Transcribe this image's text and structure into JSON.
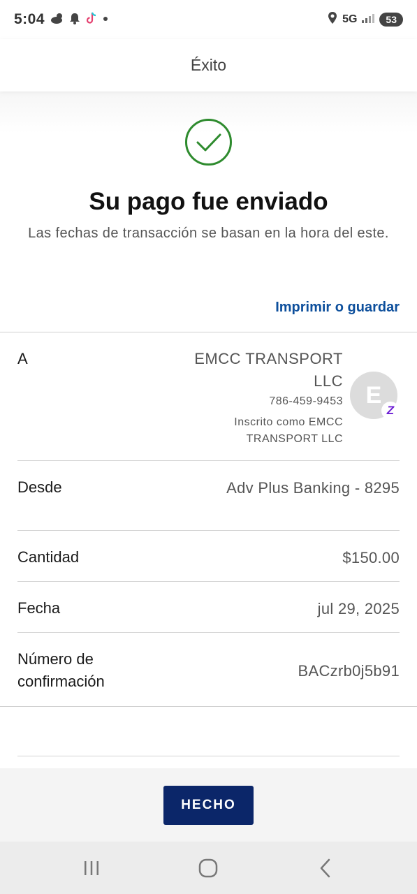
{
  "status_bar": {
    "time": "5:04",
    "network": "5G",
    "battery": "53",
    "icons": [
      "weather-icon",
      "notification-bell-icon",
      "tiktok-icon",
      "dot-icon",
      "location-icon",
      "signal-icon"
    ]
  },
  "header": {
    "title": "Éxito"
  },
  "confirmation": {
    "icon": "check-circle-icon",
    "title": "Su pago fue enviado",
    "subtitle": "Las fechas de transacción se basan en la hora del este.",
    "print_link": "Imprimir o guardar"
  },
  "payee": {
    "label": "A",
    "name": "EMCC TRANSPORT LLC",
    "phone": "786-459-9453",
    "enrolled_as": "Inscrito como EMCC TRANSPORT LLC",
    "avatar_letter": "E",
    "badge": "Z"
  },
  "details": [
    {
      "label": "Desde",
      "value": "Adv Plus Banking - 8295"
    },
    {
      "label": "Cantidad",
      "value": "$150.00"
    },
    {
      "label": "Fecha",
      "value": "jul 29, 2025"
    },
    {
      "label": "Número de confirmación",
      "value": "BACzrb0j5b91"
    }
  ],
  "footer": {
    "done_label": "HECHO"
  },
  "colors": {
    "primary": "#0b2669",
    "link": "#0d4f9c",
    "success": "#2e8b2e",
    "zelle": "#6d1ed4"
  }
}
